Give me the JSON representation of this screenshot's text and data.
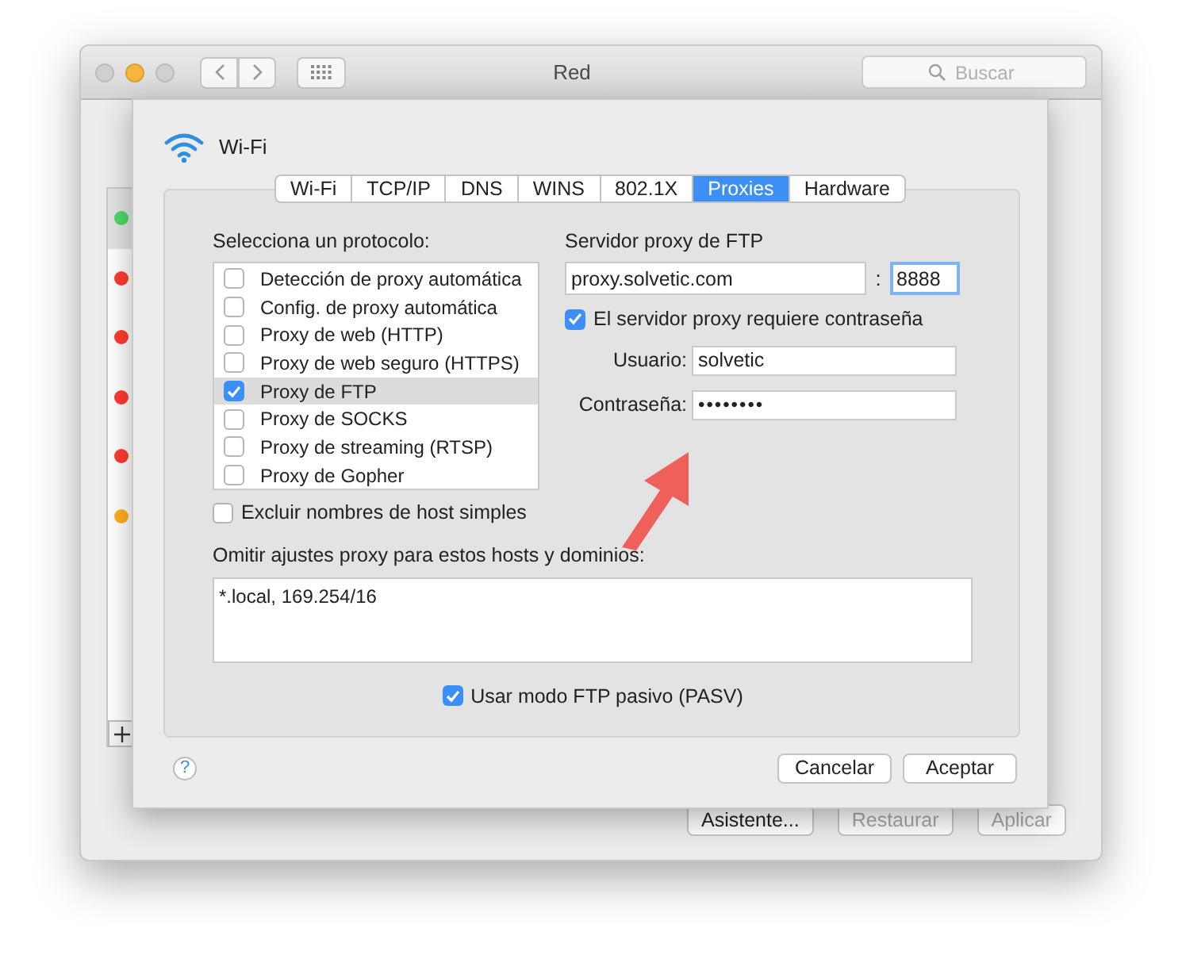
{
  "window": {
    "title": "Red",
    "search": {
      "placeholder": "Buscar"
    }
  },
  "services": [
    {
      "color": "#4cd964"
    },
    {
      "color": "#ff3b30"
    },
    {
      "color": "#ff3b30"
    },
    {
      "color": "#ff3b30"
    },
    {
      "color": "#ff3b30"
    },
    {
      "color": "#ffb020"
    }
  ],
  "background_buttons": [
    {
      "label": "Asistente...",
      "disabled": false
    },
    {
      "label": "Restaurar",
      "disabled": true
    },
    {
      "label": "Aplicar",
      "disabled": true
    }
  ],
  "sheet": {
    "title": "Wi-Fi",
    "tabs": [
      {
        "label": "Wi-Fi",
        "selected": false
      },
      {
        "label": "TCP/IP",
        "selected": false
      },
      {
        "label": "DNS",
        "selected": false
      },
      {
        "label": "WINS",
        "selected": false
      },
      {
        "label": "802.1X",
        "selected": false
      },
      {
        "label": "Proxies",
        "selected": true
      },
      {
        "label": "Hardware",
        "selected": false
      }
    ],
    "protocol_label": "Selecciona un protocolo:",
    "protocols": [
      {
        "label": "Detección de proxy automática",
        "checked": false,
        "selected": false
      },
      {
        "label": "Config. de proxy automática",
        "checked": false,
        "selected": false
      },
      {
        "label": "Proxy de web (HTTP)",
        "checked": false,
        "selected": false
      },
      {
        "label": "Proxy de web seguro (HTTPS)",
        "checked": false,
        "selected": false
      },
      {
        "label": "Proxy de FTP",
        "checked": true,
        "selected": true
      },
      {
        "label": "Proxy de SOCKS",
        "checked": false,
        "selected": false
      },
      {
        "label": "Proxy de streaming (RTSP)",
        "checked": false,
        "selected": false
      },
      {
        "label": "Proxy de Gopher",
        "checked": false,
        "selected": false
      }
    ],
    "server_label": "Servidor proxy de FTP",
    "host": "proxy.solvetic.com",
    "separator": ":",
    "port": "8888",
    "requires_password": {
      "label": "El servidor proxy requiere contraseña",
      "checked": true
    },
    "user": {
      "label": "Usuario:",
      "value": "solvetic"
    },
    "password": {
      "label": "Contraseña:",
      "value": "••••••••"
    },
    "exclude_simple": {
      "label": "Excluir nombres de host simples",
      "checked": false
    },
    "bypass_label": "Omitir ajustes proxy para estos hosts y dominios:",
    "bypass_value": "*.local, 169.254/16",
    "passive": {
      "label": "Usar modo FTP pasivo (PASV)",
      "checked": true
    },
    "help": "?",
    "buttons": [
      "Cancelar",
      "Aceptar"
    ]
  }
}
